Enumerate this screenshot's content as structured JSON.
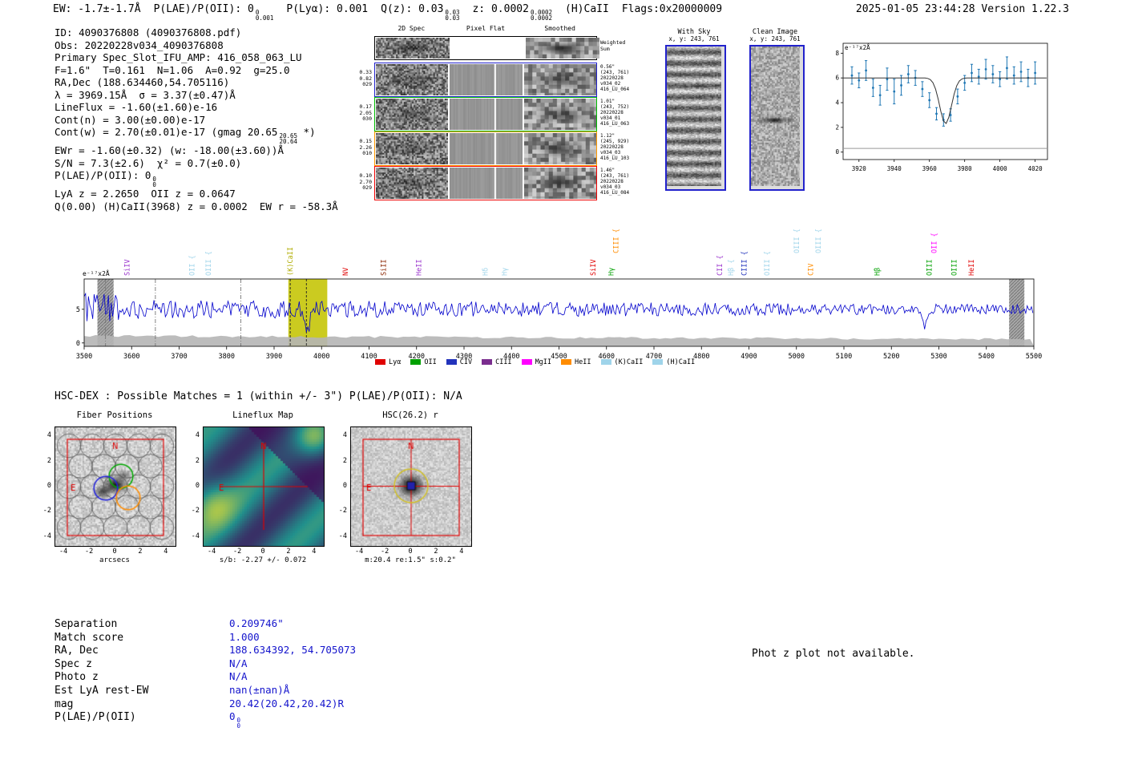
{
  "header": {
    "segments": [
      {
        "t": "EW: -1.7±-1.7Å"
      },
      {
        "t": "P(LAE)/P(OII): 0",
        "sup": "0",
        "sub": "0.001"
      },
      {
        "t": "P(Lyα): 0.001"
      },
      {
        "t": "Q(z): 0.03",
        "sup": "0.03",
        "sub": "0.03"
      },
      {
        "t": "z: 0.0002",
        "sup": "0.0002",
        "sub": "0.0002"
      },
      {
        "t": "(H)CaII"
      },
      {
        "t": "Flags:0x20000009"
      }
    ],
    "timestamp": "2025-01-05 23:44:28  Version 1.22.3"
  },
  "info_lines": [
    {
      "t": "ID: 4090376808 (4090376808.pdf)"
    },
    {
      "t": "Obs: 20220228v034_4090376808"
    },
    {
      "t": "Primary Spec_Slot_IFU_AMP: 416_058_063_LU"
    },
    {
      "t": "F=1.6\"  T=0.161  N=1.06  A=0.92  g=25.0"
    },
    {
      "t": "RA,Dec (188.634460,54.705116)"
    },
    {
      "t": "λ = 3969.15Å  σ = 3.37(±0.47)Å"
    },
    {
      "t": "LineFlux = -1.60(±1.60)e-16"
    },
    {
      "t": "Cont(n) = 3.00(±0.00)e-17"
    },
    {
      "t": "Cont(w) = 2.70(±0.01)e-17 (gmag 20.65",
      "sup": "20.65",
      "sub": "20.64",
      "t2": " *)"
    },
    {
      "t": "EWr = -1.60(±0.32) (w: -18.00(±3.60))Å"
    },
    {
      "t": "S/N = 7.3(±2.6)  χ² = 0.7(±0.0)"
    },
    {
      "t": "P(LAE)/P(OII): 0",
      "sup": "0",
      "sub": "0"
    },
    {
      "t": "LyA z = 2.2650  OII z = 0.0647"
    },
    {
      "t": "Q(0.00) (H)CaII(3968) z = 0.0002  EW r = -58.3Å"
    }
  ],
  "cutouts": {
    "col_titles": [
      "2D Spec",
      "Pixel Flat",
      "Smoothed"
    ],
    "weighted_label_lines": [
      "Weighted",
      "Sum"
    ],
    "rows": [
      {
        "color": "#2222cc",
        "left": [
          "0.33",
          "0.82",
          "029"
        ],
        "right": [
          "0.56\"",
          "(243, 761)",
          "20220228",
          "v034_02",
          "416_LU_064"
        ]
      },
      {
        "color": "#00bb00",
        "left": [
          "0.17",
          "2.05",
          "030"
        ],
        "right": [
          "1.01\"",
          "(243, 752)",
          "20220228",
          "v034_01",
          "416_LU_063"
        ]
      },
      {
        "color": "#ff9900",
        "left": [
          "0.15",
          "2.26",
          "010"
        ],
        "right": [
          "1.12\"",
          "(245, 929)",
          "20220228",
          "v034_03",
          "416_LU_103"
        ]
      },
      {
        "color": "#ee0000",
        "left": [
          "0.10",
          "2.70",
          "029"
        ],
        "right": [
          "1.46\"",
          "(243, 761)",
          "20220228",
          "v034_03",
          "416_LU_084"
        ]
      }
    ]
  },
  "sky_panels": [
    {
      "title": "With Sky",
      "coords": "x, y: 243, 761"
    },
    {
      "title": "Clean Image",
      "coords": "x, y: 243, 761"
    }
  ],
  "hsc": {
    "header": "HSC-DEX : Possible Matches = 1 (within +/- 3\")  P(LAE)/P(OII): N/A",
    "panels": [
      {
        "title": "Fiber Positions",
        "xlabel": "arcsecs",
        "ticks": [
          -4,
          -2,
          0,
          2,
          4
        ],
        "compass": [
          "N",
          "E"
        ]
      },
      {
        "title": "Lineflux Map",
        "xlabel": "s/b: -2.27 +/- 0.072",
        "ticks": [
          -4,
          -2,
          0,
          2,
          4
        ],
        "compass": [
          "N",
          "E"
        ]
      },
      {
        "title": "HSC(26.2) r",
        "xlabel": "m:20.4 re:1.5\" s:0.2\"",
        "ticks": [
          -4,
          -2,
          0,
          2,
          4
        ],
        "compass": [
          "N",
          "E"
        ]
      }
    ]
  },
  "match": {
    "rows": [
      {
        "label": "Separation",
        "value": "0.209746\""
      },
      {
        "label": "Match score",
        "value": "1.000"
      },
      {
        "label": "RA, Dec",
        "value": "188.634392, 54.705073"
      },
      {
        "label": "Spec z",
        "value": "N/A"
      },
      {
        "label": "Photo z",
        "value": "N/A"
      },
      {
        "label": "Est LyA rest-EW",
        "value": "nan(±nan)Å"
      },
      {
        "label": "mag",
        "value": "20.42(20.42,20.42)R"
      },
      {
        "label": "P(LAE)/P(OII)",
        "value": "0",
        "sup": "0",
        "sub": "0"
      }
    ]
  },
  "photz_note": "Phot z plot not available.",
  "chart_data": [
    {
      "name": "emission_line_fit",
      "type": "scatter",
      "unit_label": "e⁻¹⁷x2Å",
      "xlim": [
        3911,
        4027
      ],
      "ylim": [
        -0.6,
        8.8
      ],
      "x_ticks": [
        3920,
        3940,
        3960,
        3980,
        4000,
        4020
      ],
      "y_ticks": [
        0,
        2,
        4,
        6,
        8
      ],
      "gray_line_y": 0.3,
      "point_color": "#1f77b4",
      "fit_color": "#333333",
      "points": [
        [
          3916,
          6.2,
          0.7
        ],
        [
          3920,
          5.8,
          0.6
        ],
        [
          3924,
          6.6,
          0.8
        ],
        [
          3928,
          5.2,
          0.7
        ],
        [
          3932,
          4.6,
          0.8
        ],
        [
          3936,
          5.9,
          0.9
        ],
        [
          3940,
          4.9,
          1.0
        ],
        [
          3944,
          5.4,
          0.8
        ],
        [
          3948,
          6.3,
          0.7
        ],
        [
          3952,
          6.0,
          0.6
        ],
        [
          3956,
          5.1,
          0.6
        ],
        [
          3960,
          4.2,
          0.6
        ],
        [
          3964,
          3.1,
          0.5
        ],
        [
          3968,
          2.6,
          0.5
        ],
        [
          3972,
          3.0,
          0.5
        ],
        [
          3976,
          4.5,
          0.6
        ],
        [
          3980,
          5.6,
          0.6
        ],
        [
          3984,
          6.4,
          0.7
        ],
        [
          3988,
          6.1,
          0.6
        ],
        [
          3992,
          6.7,
          0.8
        ],
        [
          3996,
          6.3,
          0.7
        ],
        [
          4000,
          5.9,
          0.6
        ],
        [
          4004,
          6.8,
          0.9
        ],
        [
          4008,
          6.2,
          0.7
        ],
        [
          4012,
          6.5,
          0.8
        ],
        [
          4016,
          6.0,
          0.7
        ],
        [
          4020,
          6.4,
          0.9
        ]
      ],
      "fit": {
        "continuum": 6.0,
        "center": 3969.15,
        "sigma": 3.37,
        "depth": 3.7
      }
    },
    {
      "name": "full_spectrum",
      "type": "line",
      "unit_label": "e⁻¹⁷x2Å",
      "xlim": [
        3500,
        5500
      ],
      "ylim": [
        -0.5,
        9.5
      ],
      "x_ticks": [
        3500,
        3600,
        3700,
        3800,
        3900,
        4000,
        4100,
        4200,
        4300,
        4400,
        4500,
        4600,
        4700,
        4800,
        4900,
        5000,
        5100,
        5200,
        5300,
        5400,
        5500
      ],
      "y_ticks": [
        0,
        5
      ],
      "baseline": 5,
      "noise_seed": 4242,
      "line_color": "#0000cc",
      "highlight_band": {
        "range": [
          3930,
          4012
        ],
        "color": "#c8c814"
      },
      "gray_bands": [
        [
          3528,
          3562
        ],
        [
          5448,
          5480
        ]
      ],
      "dash_lines_gray": [
        3545,
        3650,
        3830
      ],
      "dash_lines_black": [
        3934,
        3968
      ],
      "absorption": {
        "center": 3969,
        "depth": 3.4,
        "sigma": 5
      },
      "spike_down": {
        "center": 5270,
        "depth": 3.0,
        "sigma": 4
      },
      "legend": [
        {
          "label": "Lyα",
          "color": "#e00000"
        },
        {
          "label": "OII",
          "color": "#00a000"
        },
        {
          "label": "CIV",
          "color": "#2233bb"
        },
        {
          "label": "CIII",
          "color": "#7a2d8e"
        },
        {
          "label": "MgII",
          "color": "#ff00ff"
        },
        {
          "label": "HeII",
          "color": "#ff8c00"
        },
        {
          "label": "(K)CaII",
          "color": "#9fd4ea"
        },
        {
          "label": "(H)CaII",
          "color": "#9fd4ea"
        }
      ],
      "line_labels": [
        {
          "text": "SiIV",
          "wave": 3590,
          "color": "#9932cc",
          "row": 0
        },
        {
          "text": "OII {",
          "wave": 3727,
          "color": "#9fd4ea",
          "row": 0
        },
        {
          "text": "OIII {",
          "wave": 3762,
          "color": "#9fd4ea",
          "row": 0
        },
        {
          "text": "(K)CaII",
          "wave": 3934,
          "color": "#b0ac00",
          "row": 0
        },
        {
          "text": "NV",
          "wave": 4050,
          "color": "#e00000",
          "row": 0
        },
        {
          "text": "SiII",
          "wave": 4130,
          "color": "#8b2500",
          "row": 0
        },
        {
          "text": "HeII",
          "wave": 4205,
          "color": "#9932cc",
          "row": 0
        },
        {
          "text": "Hδ",
          "wave": 4345,
          "color": "#9fd4ea",
          "row": 0
        },
        {
          "text": "Hγ",
          "wave": 4385,
          "color": "#9fd4ea",
          "row": 0
        },
        {
          "text": "SiIV",
          "wave": 4572,
          "color": "#e00000",
          "row": 0
        },
        {
          "text": "Hγ",
          "wave": 4610,
          "color": "#00a000",
          "row": 0
        },
        {
          "text": "CIII {",
          "wave": 4620,
          "color": "#ff8c00",
          "row": 1
        },
        {
          "text": "CII {",
          "wave": 4838,
          "color": "#9932cc",
          "row": 0
        },
        {
          "text": "Hβ {",
          "wave": 4862,
          "color": "#9fd4ea",
          "row": 0
        },
        {
          "text": "CIII {",
          "wave": 4890,
          "color": "#2233bb",
          "row": 0
        },
        {
          "text": "OIII {",
          "wave": 4938,
          "color": "#9fd4ea",
          "row": 0
        },
        {
          "text": "OIII {",
          "wave": 5000,
          "color": "#9fd4ea",
          "row": 1
        },
        {
          "text": "OIII {",
          "wave": 5046,
          "color": "#9fd4ea",
          "row": 1
        },
        {
          "text": "CIV",
          "wave": 5030,
          "color": "#ff8c00",
          "row": 0
        },
        {
          "text": "Hβ",
          "wave": 5170,
          "color": "#00a000",
          "row": 0
        },
        {
          "text": "OII {",
          "wave": 5290,
          "color": "#ff00ff",
          "row": 1
        },
        {
          "text": "OIII",
          "wave": 5280,
          "color": "#00a000",
          "row": 0
        },
        {
          "text": "OIII",
          "wave": 5332,
          "color": "#00a000",
          "row": 0
        },
        {
          "text": "HeII",
          "wave": 5368,
          "color": "#e00000",
          "row": 0
        }
      ]
    }
  ]
}
